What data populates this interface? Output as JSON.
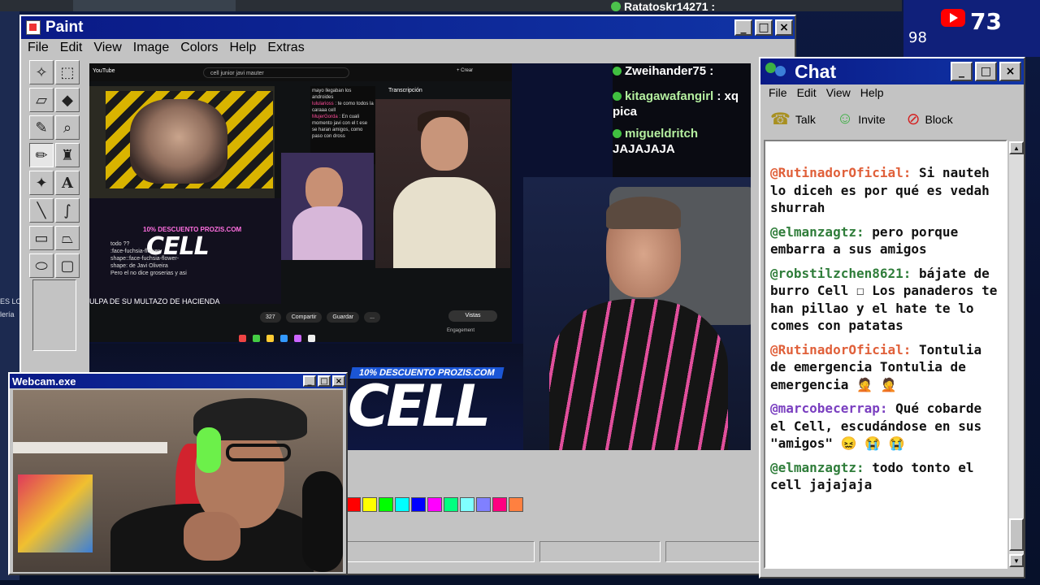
{
  "overlay": {
    "top_user": "Ratatoskr14271 :",
    "youtube_viewers": "73",
    "secondary_count": "98"
  },
  "desktop": {
    "left_text_1": "ES LO",
    "left_text_2": "lería"
  },
  "paint": {
    "title": "Paint",
    "menu": [
      "File",
      "Edit",
      "View",
      "Image",
      "Colors",
      "Help",
      "Extras"
    ],
    "palette": [
      "#ff0000",
      "#ffff00",
      "#00ff00",
      "#00ffff",
      "#0000ff",
      "#ff00ff",
      "#00ff80",
      "#80ffff",
      "#8080ff",
      "#ff0080",
      "#ff8040"
    ]
  },
  "canvas": {
    "yt_logo": "YouTube",
    "yt_search": "cell junior javi mauter",
    "yt_create": "+ Crear",
    "transcription_label": "Transcripción",
    "yt_chat": [
      {
        "user": "",
        "text": "mayo llegaban los androides"
      },
      {
        "user": "lulularioss",
        "text": ": te como todos la caraaa cell"
      },
      {
        "user": "MujerGorda",
        "text": ": En cuali momento javi con el t ese se haran amigos, como paso con dross"
      }
    ],
    "prozis_small": "10% DESCUENTO PROZIS.COM",
    "cell_small": "CELL",
    "yt_comments": [
      "todo ??",
      ":face-fuchsia-flower-",
      "shape::face-fuchsia-flower-",
      "shape: de Javi Oliveira",
      "Pero el no dice groserias y asi"
    ],
    "yt_caption": "ULPA DE SU MULTAZO DE HACIENDA",
    "yt_actions": [
      "327",
      "Compartir",
      "Guardar",
      "..."
    ],
    "yt_vistas": "Vistas",
    "yt_engagement": "Engagement",
    "prozis_banner": "10% DESCUENTO PROZIS.COM",
    "cell_banner": "CELL"
  },
  "twitch_chat": [
    {
      "user": "Zweihander75",
      "text": ":"
    },
    {
      "user": "kitagawafangirl",
      "text": ": xq pica"
    },
    {
      "user": "migueldritch",
      "text": "JAJAJAJA"
    }
  ],
  "chat": {
    "title": "Chat",
    "menu": [
      "File",
      "Edit",
      "View",
      "Help"
    ],
    "tools": [
      "Talk",
      "Invite",
      "Block"
    ],
    "messages": [
      {
        "user": "@RutinadorOficial:",
        "text": "Si nauteh lo diceh es por qué es vedah shurrah"
      },
      {
        "user": "@elmanzagtz:",
        "text": "pero porque embarra a sus amigos"
      },
      {
        "user": "@robstilzchen8621:",
        "text": "bájate de burro Cell ☐ Los panaderos te han pillao y el hate te lo comes con patatas"
      },
      {
        "user": "@RutinadorOficial:",
        "text": "Tontulia de emergencia Tontulia de emergencia 🤦 🤦"
      },
      {
        "user": "@marcobecerrap:",
        "text": "Qué cobarde el Cell, escudándose en sus \"amigos\" 😖 😭 😭"
      },
      {
        "user": "@elmanzagtz:",
        "text": "todo tonto el cell jajajaja"
      }
    ]
  },
  "webcam": {
    "title": "Webcam.exe"
  }
}
